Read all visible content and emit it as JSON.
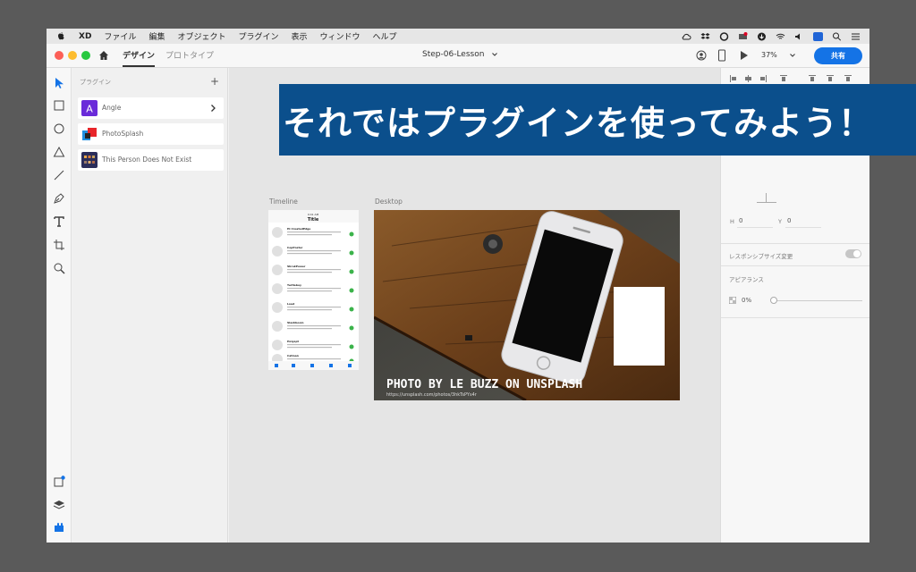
{
  "menubar": {
    "app": "XD",
    "items": [
      "ファイル",
      "編集",
      "オブジェクト",
      "プラグイン",
      "表示",
      "ウィンドウ",
      "ヘルプ"
    ]
  },
  "titlebar": {
    "tabs": [
      "デザイン",
      "プロトタイプ"
    ],
    "active_tab": "デザイン",
    "document_title": "Step-06-Lesson",
    "zoom": "37%",
    "share_label": "共有"
  },
  "plugins_panel": {
    "header": "プラグイン",
    "add_label": "+",
    "items": [
      {
        "name": "Angle",
        "icon": "angle-plugin-icon",
        "color": "#6a2bd9"
      },
      {
        "name": "PhotoSplash",
        "icon": "photosplash-plugin-icon",
        "color": "#e8252a"
      },
      {
        "name": "This Person Does Not Exist",
        "icon": "person-plugin-icon",
        "color": "#2b2d5a"
      }
    ]
  },
  "canvas": {
    "artboards": [
      {
        "label": "Timeline"
      },
      {
        "label": "Desktop"
      }
    ],
    "timeline": {
      "status_time": "9:41 AM",
      "title": "Title",
      "items": [
        "Hi CreatedEdge",
        "CopPoster",
        "ShrekPower",
        "Turtleboy",
        "Loud",
        "Slashboom",
        "Holyspt",
        "Catman"
      ]
    },
    "desktop": {
      "photo_credit": "PHOTO BY LE BUZZ ON UNSPLASH",
      "photo_url": "https://unsplash.com/photos/3hkTsPYs4r"
    }
  },
  "props_panel": {
    "h_label": "H",
    "h_value": "0",
    "y_label": "Y",
    "y_value": "0",
    "responsive_label": "レスポンシブサイズ変更",
    "appearance_label": "アピアランス",
    "opacity": "0%"
  },
  "banner": {
    "text": "それではプラグインを使ってみよう！"
  },
  "colors": {
    "accent": "#1473e6",
    "banner": "#0b4f8c"
  }
}
